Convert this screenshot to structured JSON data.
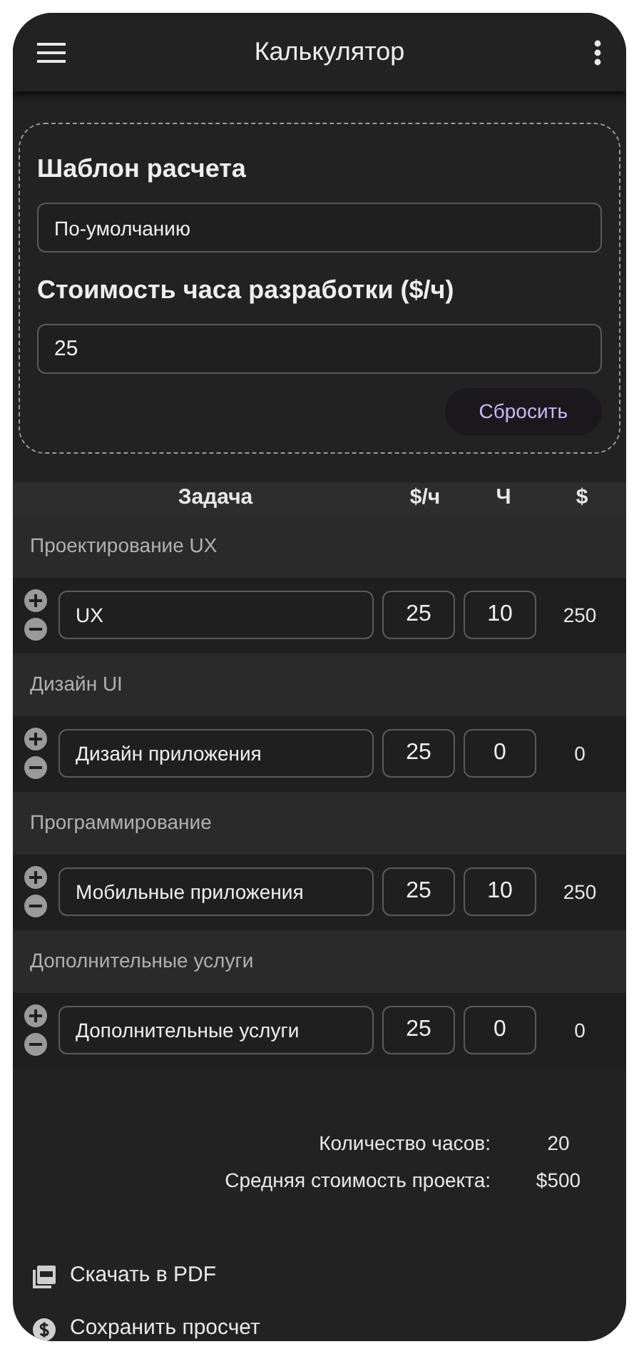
{
  "app_bar": {
    "title": "Калькулятор"
  },
  "template": {
    "label": "Шаблон расчета",
    "value": "По-умолчанию"
  },
  "rate": {
    "label": "Стоимость часа разработки ($/ч)",
    "value": "25"
  },
  "reset_button": "Сбросить",
  "table": {
    "columns": [
      "Задача",
      "$/ч",
      "Ч",
      "$"
    ],
    "groups": [
      {
        "category": "Проектирование UX",
        "items": [
          {
            "task": "UX",
            "rate": "25",
            "hours": "10",
            "total": "250"
          }
        ]
      },
      {
        "category": "Дизайн UI",
        "items": [
          {
            "task": "Дизайн приложения",
            "rate": "25",
            "hours": "0",
            "total": "0"
          }
        ]
      },
      {
        "category": "Программирование",
        "items": [
          {
            "task": "Мобильные приложения",
            "rate": "25",
            "hours": "10",
            "total": "250"
          }
        ]
      },
      {
        "category": "Дополнительные услуги",
        "items": [
          {
            "task": "Дополнительные услуги",
            "rate": "25",
            "hours": "0",
            "total": "0"
          }
        ]
      }
    ]
  },
  "summary": [
    {
      "label": "Количество часов:",
      "value": "20"
    },
    {
      "label": "Средняя стоимость проекта:",
      "value": "$500"
    }
  ],
  "actions": [
    {
      "kind": "pdf",
      "label": "Скачать в PDF"
    },
    {
      "kind": "save",
      "label": "Сохранить просчет"
    }
  ]
}
